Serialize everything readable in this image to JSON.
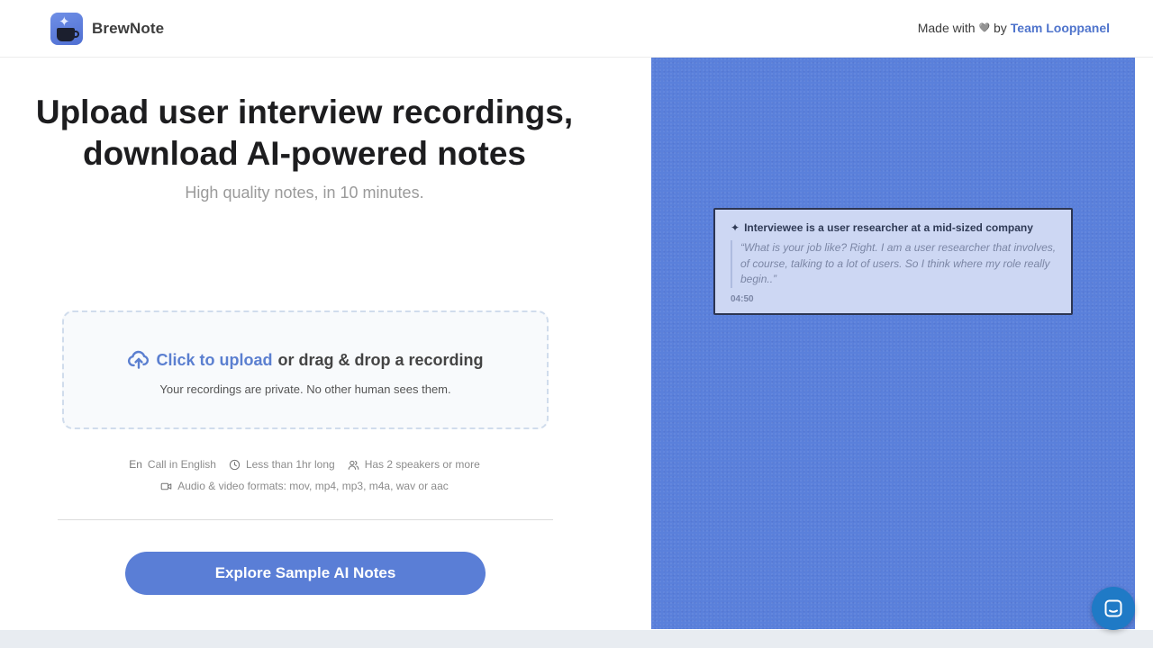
{
  "header": {
    "brand_name": "BrewNote",
    "credit_prefix": "Made with",
    "credit_heart": "🩶",
    "credit_by": "by",
    "credit_link": "Team Looppanel"
  },
  "hero": {
    "headline_line1": "Upload user interview recordings,",
    "headline_line2": "download AI-powered notes",
    "subhead": "High quality notes, in 10 minutes."
  },
  "upload": {
    "link_text": "Click to upload",
    "rest_text": "or drag & drop a recording",
    "privacy_note": "Your recordings are private. No other human sees them."
  },
  "requirements": {
    "language_glyph": "En",
    "language": "Call in English",
    "duration": "Less than 1hr long",
    "speakers": "Has 2 speakers or more",
    "formats": "Audio & video formats: mov, mp4, mp3, m4a, wav or aac"
  },
  "cta": {
    "label": "Explore Sample AI Notes"
  },
  "preview": {
    "title": "Interviewee is a user researcher at a mid-sized company",
    "quote": "“What is your job like? Right. I am a user researcher that involves, of course, talking to a lot of users. So I think where my role really begin..”",
    "timestamp": "04:50"
  },
  "colors": {
    "accent": "#5a7ed6",
    "panel": "#5a80db",
    "chat": "#1f7ac6"
  }
}
